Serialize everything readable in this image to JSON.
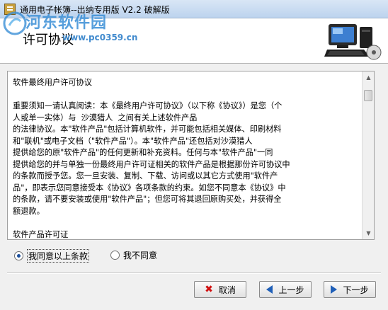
{
  "window": {
    "title": "通用电子帐簿--出纳专用版 V2.2 破解版"
  },
  "watermark": {
    "name": "河东软件园",
    "url": "www.pc0359.cn"
  },
  "header": {
    "heading": "许可协议",
    "icon": "computer-icon"
  },
  "license": {
    "paragraphs": [
      "软件最终用户许可协议",
      "",
      "重要须知—请认真阅读：本《最终用户许可协议》（以下称《协议》）是您（个\n人或单一实体）与  沙漠猎人  之间有关上述软件产品\n的法律协议。本\"软件产品\"包括计算机软件，并可能包括相关媒体、印刷材料\n和\"联机\"或电子文档（\"软件产品\"）。本\"软件产品\"还包括对沙漠猎人\n提供给您的原\"软件产品\"的任何更新和补充资料。任何与本\"软件产品\"一同\n提供给您的并与单独一份最终用户许可证相关的软件产品是根据那份许可协议中\n的条款而授予您。您一旦安装、复制、下载、访问或以其它方式使用\"软件产\n品\"，即表示您同意接受本《协议》各项条款的约束。如您不同意本《协议》中\n的条款，请不要安装或使用\"软件产品\"；但您可将其退回原购买处，并获得全\n额退款。",
      "",
      "软件产品许可证"
    ]
  },
  "options": {
    "agree": "我同意以上条款",
    "disagree": "我不同意",
    "selected": "agree"
  },
  "buttons": {
    "cancel": "取消",
    "back": "上一步",
    "next": "下一步"
  },
  "colors": {
    "window_bg": "#f0f0f0",
    "titlebar": "#c6d9f0",
    "watermark": "#3a8fd6",
    "accent_arrow": "#1f5fb8",
    "cancel_x": "#d01010"
  }
}
